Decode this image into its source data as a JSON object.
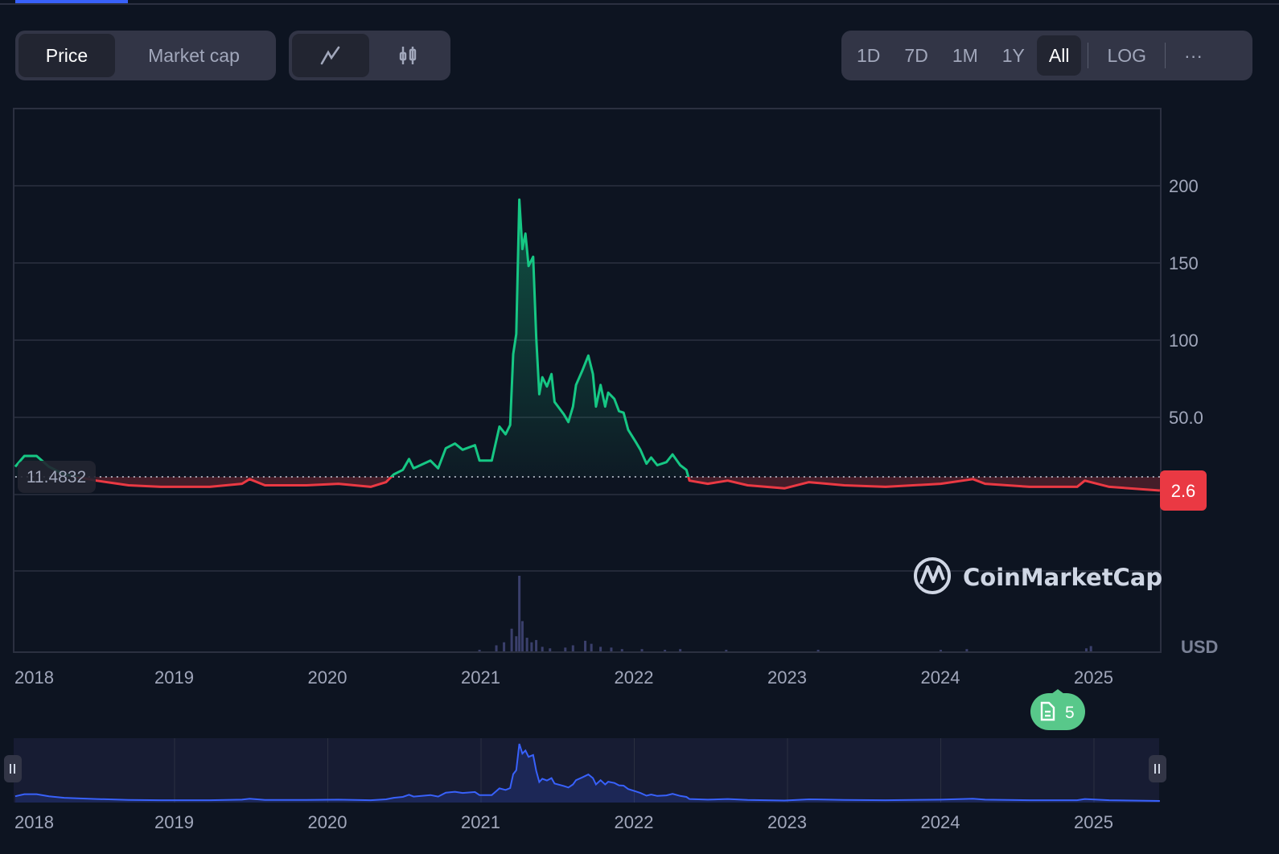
{
  "toolbar": {
    "metric_tabs": [
      {
        "label": "Price",
        "selected": true
      },
      {
        "label": "Market cap",
        "selected": false
      }
    ],
    "chart_types": [
      {
        "icon": "line-chart-icon",
        "selected": true
      },
      {
        "icon": "candlestick-icon",
        "selected": false
      }
    ],
    "timeframes": [
      {
        "label": "1D"
      },
      {
        "label": "7D"
      },
      {
        "label": "1M"
      },
      {
        "label": "1Y"
      },
      {
        "label": "All",
        "selected": true
      }
    ],
    "log_label": "LOG",
    "more_label": "···"
  },
  "chart_data": {
    "type": "line",
    "currency_label": "USD",
    "baseline_label": "11.4832",
    "baseline": 11.4832,
    "current_price_label": "2.6",
    "current_price": 2.6,
    "yticks": [
      {
        "v": 200,
        "label": "200"
      },
      {
        "v": 150,
        "label": "150"
      },
      {
        "v": 100,
        "label": "100"
      },
      {
        "v": 50,
        "label": "50.0"
      }
    ],
    "ylim": [
      0,
      250
    ],
    "xticks": [
      {
        "v": 2018,
        "label": "2018"
      },
      {
        "v": 2019,
        "label": "2019"
      },
      {
        "v": 2020,
        "label": "2020"
      },
      {
        "v": 2021,
        "label": "2021"
      },
      {
        "v": 2022,
        "label": "2022"
      },
      {
        "v": 2023,
        "label": "2023"
      },
      {
        "v": 2024,
        "label": "2024"
      },
      {
        "v": 2025,
        "label": "2025"
      }
    ],
    "xlim": [
      2017.96,
      2025.43
    ],
    "series": [
      {
        "name": "Price",
        "points": [
          [
            2017.96,
            18
          ],
          [
            2018.02,
            25
          ],
          [
            2018.1,
            25
          ],
          [
            2018.18,
            18
          ],
          [
            2018.28,
            13
          ],
          [
            2018.49,
            9
          ],
          [
            2018.7,
            6
          ],
          [
            2018.91,
            5
          ],
          [
            2019.23,
            5
          ],
          [
            2019.44,
            7
          ],
          [
            2019.49,
            10
          ],
          [
            2019.59,
            6
          ],
          [
            2019.86,
            6
          ],
          [
            2020.07,
            7
          ],
          [
            2020.28,
            5
          ],
          [
            2020.38,
            8
          ],
          [
            2020.43,
            13
          ],
          [
            2020.49,
            16
          ],
          [
            2020.53,
            23
          ],
          [
            2020.56,
            17
          ],
          [
            2020.67,
            22
          ],
          [
            2020.72,
            17
          ],
          [
            2020.77,
            30
          ],
          [
            2020.83,
            33
          ],
          [
            2020.88,
            29
          ],
          [
            2020.96,
            32
          ],
          [
            2020.99,
            22
          ],
          [
            2021.07,
            22
          ],
          [
            2021.12,
            44
          ],
          [
            2021.16,
            39
          ],
          [
            2021.19,
            45
          ],
          [
            2021.21,
            91
          ],
          [
            2021.23,
            104
          ],
          [
            2021.25,
            191
          ],
          [
            2021.27,
            159
          ],
          [
            2021.29,
            169
          ],
          [
            2021.31,
            148
          ],
          [
            2021.34,
            154
          ],
          [
            2021.36,
            102
          ],
          [
            2021.38,
            65
          ],
          [
            2021.4,
            76
          ],
          [
            2021.43,
            70
          ],
          [
            2021.46,
            78
          ],
          [
            2021.48,
            60
          ],
          [
            2021.54,
            52
          ],
          [
            2021.57,
            47
          ],
          [
            2021.6,
            57
          ],
          [
            2021.62,
            71
          ],
          [
            2021.66,
            80
          ],
          [
            2021.7,
            90
          ],
          [
            2021.73,
            78
          ],
          [
            2021.75,
            57
          ],
          [
            2021.78,
            71
          ],
          [
            2021.81,
            57
          ],
          [
            2021.83,
            66
          ],
          [
            2021.87,
            62
          ],
          [
            2021.9,
            54
          ],
          [
            2021.93,
            53
          ],
          [
            2021.96,
            42
          ],
          [
            2022.01,
            34
          ],
          [
            2022.04,
            29
          ],
          [
            2022.08,
            20
          ],
          [
            2022.11,
            24
          ],
          [
            2022.15,
            19
          ],
          [
            2022.21,
            21
          ],
          [
            2022.25,
            26
          ],
          [
            2022.3,
            19
          ],
          [
            2022.34,
            16
          ],
          [
            2022.36,
            9
          ],
          [
            2022.48,
            7
          ],
          [
            2022.61,
            9
          ],
          [
            2022.74,
            6
          ],
          [
            2022.98,
            4
          ],
          [
            2023.14,
            8
          ],
          [
            2023.37,
            6
          ],
          [
            2023.64,
            5
          ],
          [
            2024.0,
            7
          ],
          [
            2024.21,
            10
          ],
          [
            2024.29,
            7
          ],
          [
            2024.58,
            5
          ],
          [
            2024.89,
            5
          ],
          [
            2024.94,
            9
          ],
          [
            2025.1,
            5
          ],
          [
            2025.43,
            2.6
          ]
        ]
      }
    ],
    "volume_relative": [
      [
        2020.99,
        0.02
      ],
      [
        2021.1,
        0.08
      ],
      [
        2021.15,
        0.12
      ],
      [
        2021.2,
        0.3
      ],
      [
        2021.23,
        0.2
      ],
      [
        2021.25,
        1.0
      ],
      [
        2021.27,
        0.4
      ],
      [
        2021.3,
        0.18
      ],
      [
        2021.33,
        0.12
      ],
      [
        2021.36,
        0.15
      ],
      [
        2021.4,
        0.06
      ],
      [
        2021.45,
        0.04
      ],
      [
        2021.55,
        0.05
      ],
      [
        2021.6,
        0.08
      ],
      [
        2021.68,
        0.14
      ],
      [
        2021.72,
        0.1
      ],
      [
        2021.78,
        0.06
      ],
      [
        2021.85,
        0.05
      ],
      [
        2021.92,
        0.03
      ],
      [
        2022.05,
        0.03
      ],
      [
        2022.2,
        0.02
      ],
      [
        2022.3,
        0.03
      ],
      [
        2022.6,
        0.02
      ],
      [
        2023.2,
        0.02
      ],
      [
        2024.0,
        0.02
      ],
      [
        2024.17,
        0.03
      ],
      [
        2024.95,
        0.04
      ],
      [
        2024.98,
        0.07
      ]
    ]
  },
  "news_badge": {
    "count": "5",
    "icon": "document-icon"
  },
  "watermark": "CoinMarketCap",
  "colors": {
    "up": "#16c784",
    "down": "#ea3943",
    "volume": "#3a3f6b",
    "navigator_line": "#3861fb"
  }
}
